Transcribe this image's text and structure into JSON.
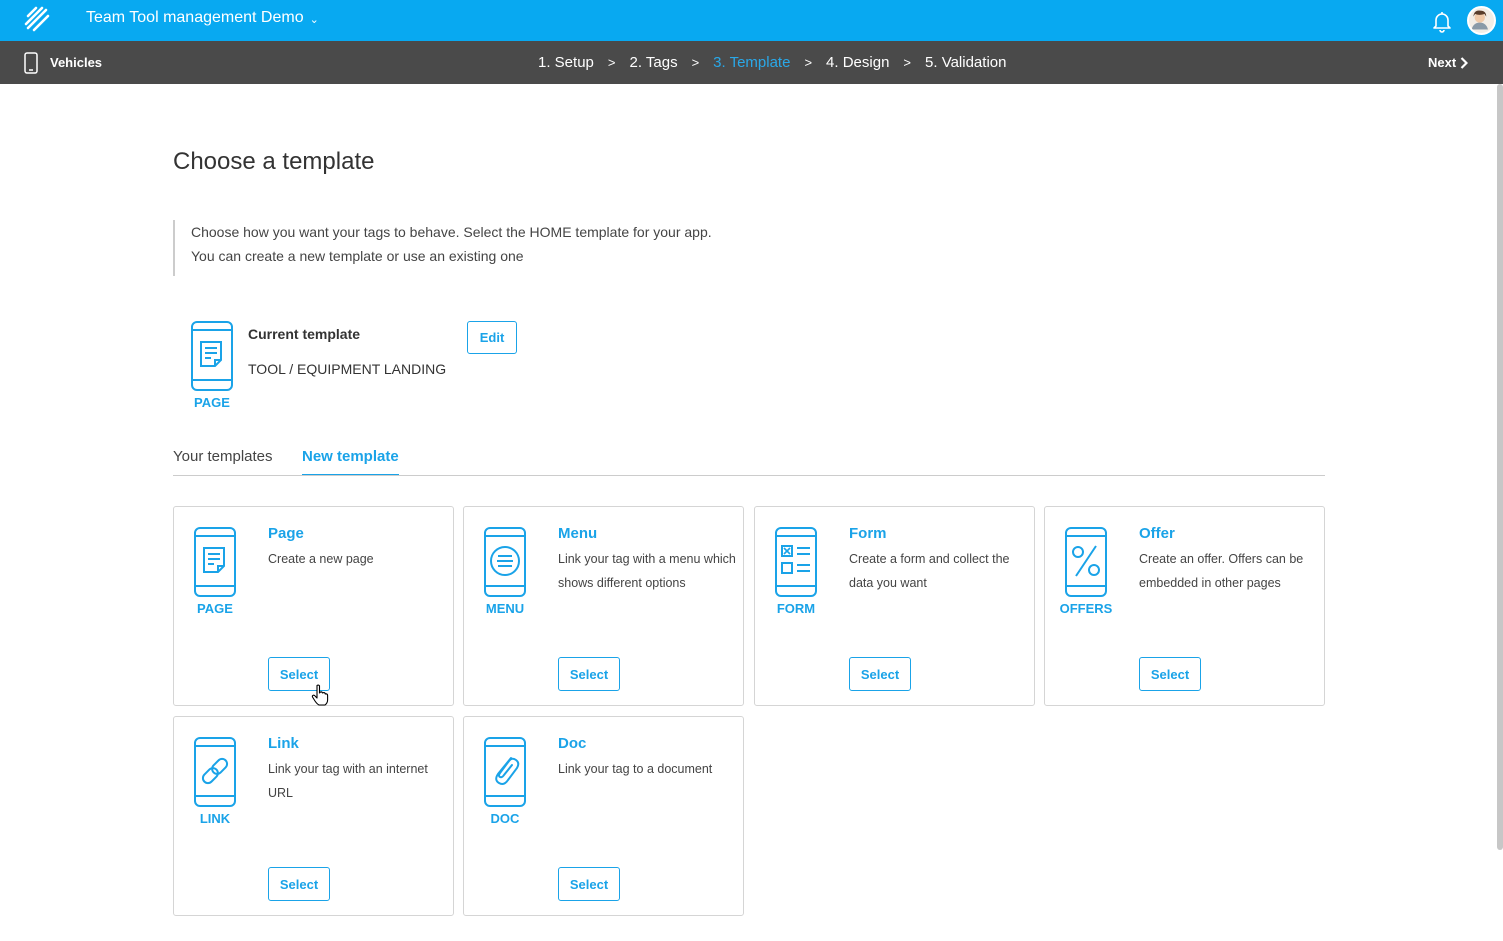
{
  "header": {
    "app_title": "Team Tool management Demo",
    "colors": {
      "brand": "#08a9f1",
      "stepbar": "#4a4a4a",
      "accent": "#1aa3e8"
    }
  },
  "stepbar": {
    "section": "Vehicles",
    "steps": [
      {
        "label": "1. Setup",
        "active": false
      },
      {
        "label": "2. Tags",
        "active": false
      },
      {
        "label": "3. Template",
        "active": true
      },
      {
        "label": "4. Design",
        "active": false
      },
      {
        "label": "5. Validation",
        "active": false
      }
    ],
    "separator": ">",
    "next_label": "Next"
  },
  "main": {
    "title": "Choose a template",
    "intro_line1": "Choose how you want your tags to behave. Select the HOME template for your app.",
    "intro_line2": "You can create a new template or use an existing one"
  },
  "current_template": {
    "icon_label": "PAGE",
    "heading": "Current template",
    "name": "TOOL / EQUIPMENT LANDING",
    "edit_label": "Edit"
  },
  "tabs": [
    {
      "label": "Your templates",
      "active": false
    },
    {
      "label": "New template",
      "active": true
    }
  ],
  "templates": [
    {
      "icon": "page-icon",
      "icon_label": "PAGE",
      "title": "Page",
      "description": "Create a new page",
      "select_label": "Select"
    },
    {
      "icon": "menu-icon",
      "icon_label": "MENU",
      "title": "Menu",
      "description": "Link your tag with a menu which shows different options",
      "select_label": "Select"
    },
    {
      "icon": "form-icon",
      "icon_label": "FORM",
      "title": "Form",
      "description": "Create a form and collect the data you want",
      "select_label": "Select"
    },
    {
      "icon": "offers-icon",
      "icon_label": "OFFERS",
      "title": "Offer",
      "description": "Create an offer. Offers can be embedded in other pages",
      "select_label": "Select"
    },
    {
      "icon": "link-icon",
      "icon_label": "LINK",
      "title": "Link",
      "description": "Link your tag with an internet URL",
      "select_label": "Select"
    },
    {
      "icon": "doc-icon",
      "icon_label": "DOC",
      "title": "Doc",
      "description": "Link your tag to a document",
      "select_label": "Select"
    }
  ]
}
